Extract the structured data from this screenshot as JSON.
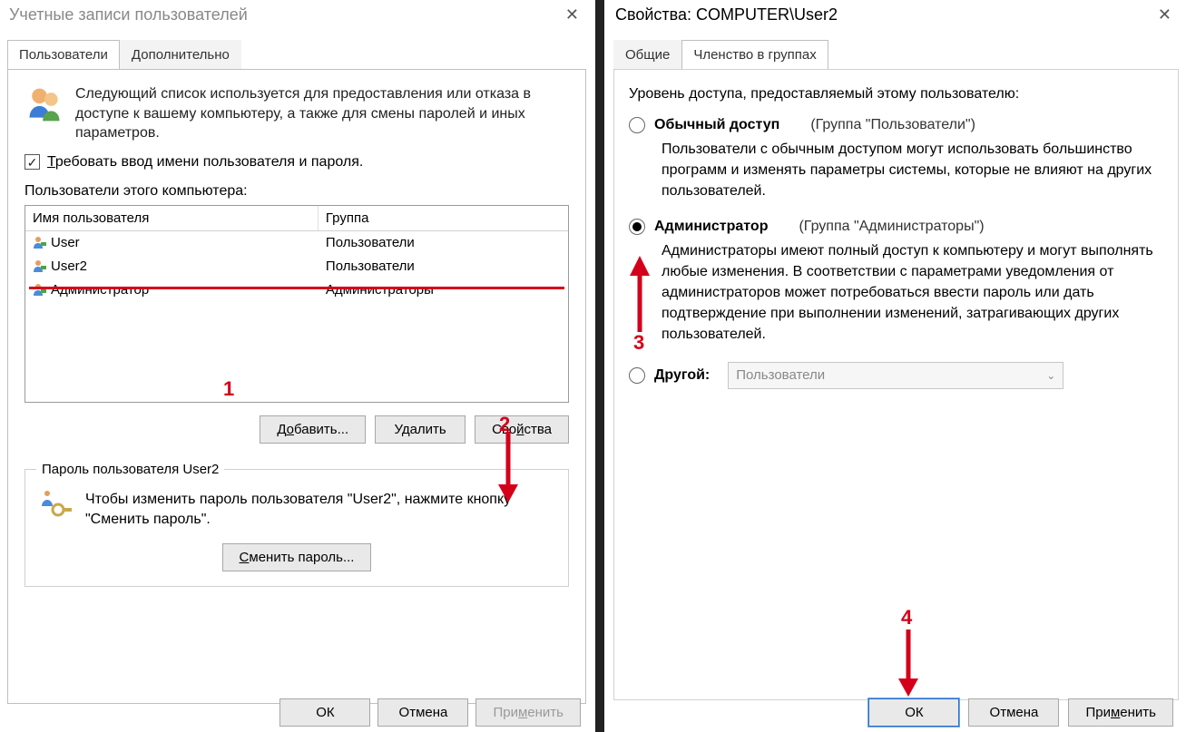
{
  "left": {
    "title": "Учетные записи пользователей",
    "tabs": {
      "users": "Пользователи",
      "advanced": "Дополнительно"
    },
    "info": "Следующий список используется для предоставления или отказа в доступе к вашему компьютеру, а также для смены паролей и иных параметров.",
    "require_credentials": "Требовать ввод имени пользователя и пароля.",
    "list_label": "Пользователи этого компьютера:",
    "columns": {
      "name": "Имя пользователя",
      "group": "Группа"
    },
    "rows": [
      {
        "name": "User",
        "group": "Пользователи"
      },
      {
        "name": "User2",
        "group": "Пользователи"
      },
      {
        "name": "Администратор",
        "group": "Администраторы"
      }
    ],
    "buttons": {
      "add": "Добавить...",
      "remove": "Удалить",
      "props": "Свойства"
    },
    "pw": {
      "legend": "Пароль пользователя User2",
      "text": "Чтобы изменить пароль пользователя \"User2\", нажмите кнопку \"Сменить пароль\".",
      "change": "Сменить пароль..."
    },
    "dlg": {
      "ok": "ОК",
      "cancel": "Отмена",
      "apply": "Применить"
    }
  },
  "right": {
    "title": "Свойства: COMPUTER\\User2",
    "tabs": {
      "general": "Общие",
      "membership": "Членство в группах"
    },
    "level_label": "Уровень доступа, предоставляемый этому пользователю:",
    "std": {
      "title": "Обычный доступ",
      "group": "(Группа \"Пользователи\")",
      "desc": "Пользователи с обычным доступом могут использовать большинство программ и изменять параметры системы, которые не влияют на других пользователей."
    },
    "admin": {
      "title": "Администратор",
      "group": "(Группа \"Администраторы\")",
      "desc": "Администраторы имеют полный доступ к компьютеру и могут выполнять любые изменения. В соответствии с параметрами уведомления от администраторов может потребоваться ввести пароль или дать подтверждение при выполнении изменений, затрагивающих других пользователей."
    },
    "other": {
      "title": "Другой:",
      "value": "Пользователи"
    },
    "dlg": {
      "ok": "ОК",
      "cancel": "Отмена",
      "apply": "Применить"
    }
  },
  "anno": {
    "n1": "1",
    "n2": "2",
    "n3": "3",
    "n4": "4"
  }
}
